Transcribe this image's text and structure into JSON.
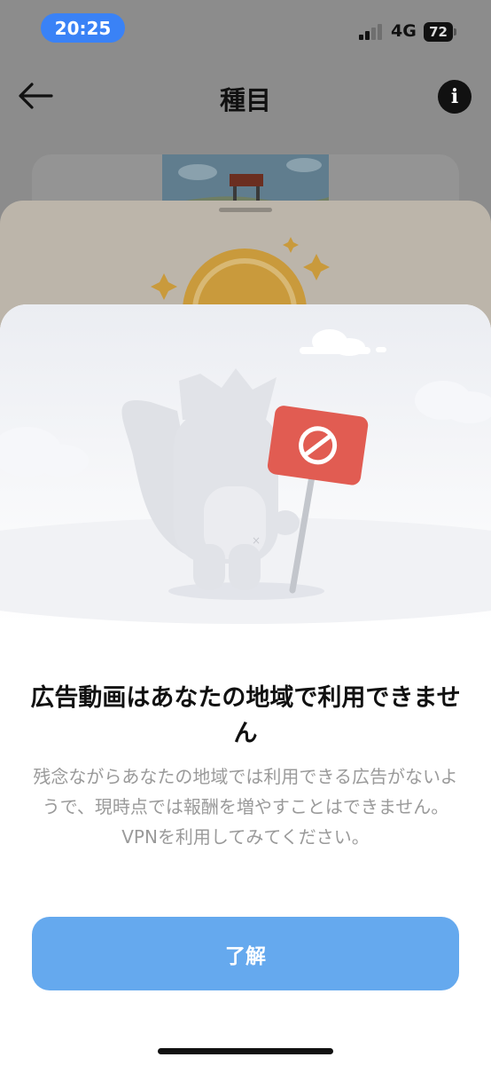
{
  "status_bar": {
    "time": "20:25",
    "network": "4G",
    "battery": "72"
  },
  "nav": {
    "title": "種目"
  },
  "dialog": {
    "title": "広告動画はあなたの地域で利用できません",
    "message": "残念ながらあなたの地域では利用できる広告がないようで、現時点では報酬を増やすことはできません。VPNを利用してみてください。",
    "ok_label": "了解"
  },
  "colors": {
    "accent": "#65a9ee",
    "time_pill": "#3a82f6",
    "sign_red": "#e15c52",
    "coin_gold": "#c99a3c",
    "overlay": "#8c8c8c"
  },
  "icons": {
    "back": "arrow-left-icon",
    "info": "info-circle-icon",
    "sign": "no-entry-icon"
  }
}
